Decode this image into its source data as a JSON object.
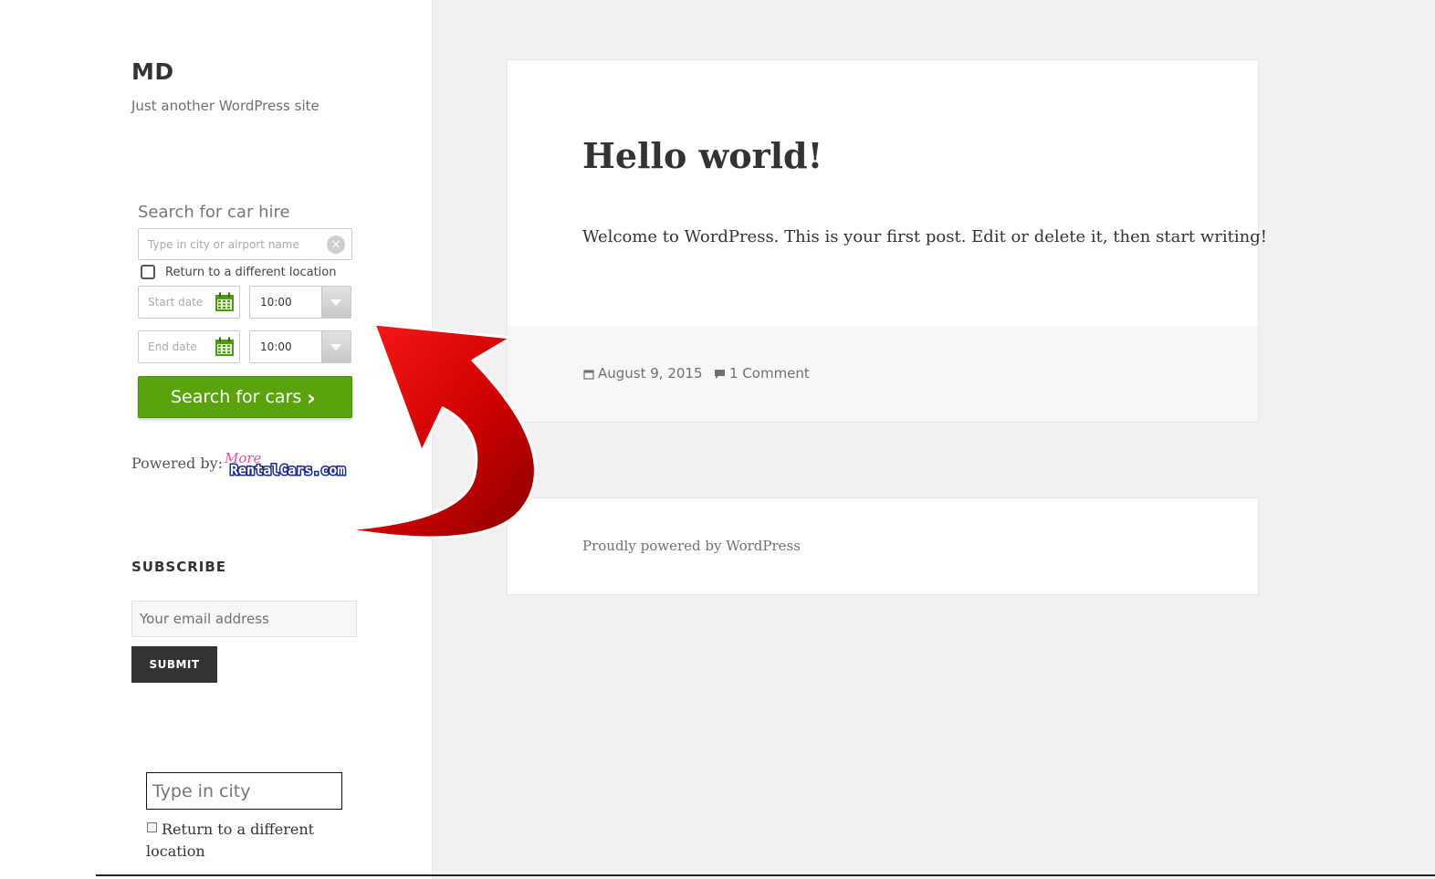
{
  "site": {
    "title": "MD",
    "description": "Just another WordPress site"
  },
  "car_hire_widget": {
    "title": "Search for car hire",
    "location_placeholder": "Type in city or airport name",
    "return_label": "Return to a different location",
    "start_date_placeholder": "Start date",
    "end_date_placeholder": "End date",
    "start_time": "10:00",
    "end_time": "10:00",
    "search_button": "Search for cars",
    "powered_by": "Powered by:",
    "logo_text": "RentalCars.com",
    "logo_script": "More",
    "accent_color": "#5aa30f"
  },
  "subscribe": {
    "title": "SUBSCRIBE",
    "email_placeholder": "Your email address",
    "submit_label": "SUBMIT"
  },
  "fallback_widget": {
    "city_placeholder": "Type in city",
    "return_label": "Return to a different location"
  },
  "post": {
    "title": "Hello world!",
    "body": "Welcome to WordPress. This is your first post. Edit or delete it, then start writing!",
    "date": "August 9, 2015",
    "comments": "1 Comment"
  },
  "footer": {
    "credit": "Proudly powered by WordPress"
  },
  "annotation": {
    "arrow_color": "#d0021b"
  }
}
